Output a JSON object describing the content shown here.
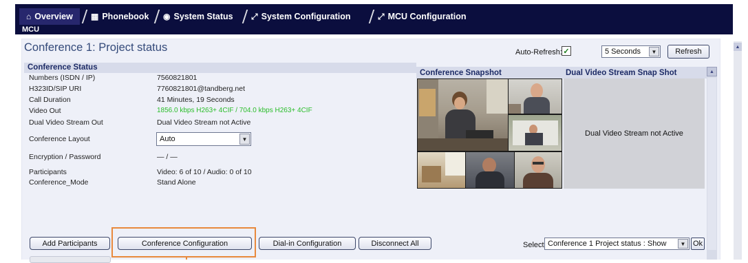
{
  "header": {
    "tabs": [
      {
        "label": "Overview",
        "icon": "home-icon",
        "glyph": "⌂",
        "active": true
      },
      {
        "label": "Phonebook",
        "icon": "phonebook-icon",
        "glyph": "▦",
        "active": false
      },
      {
        "label": "System Status",
        "icon": "gauge-icon",
        "glyph": "◉",
        "active": false
      },
      {
        "label": "System Configuration",
        "icon": "wrench-icon",
        "glyph": "⤢",
        "active": false
      },
      {
        "label": "MCU Configuration",
        "icon": "wrench-icon",
        "glyph": "⤢",
        "active": false
      }
    ],
    "breadcrumb": "MCU",
    "bar_color": "#0b0e3e"
  },
  "page": {
    "title": "Conference 1: Project status",
    "auto_refresh_label": "Auto-Refresh:",
    "auto_refresh_checked": true,
    "refresh_interval": "5 Seconds",
    "refresh_button": "Refresh"
  },
  "status": {
    "title": "Conference Status",
    "rows": [
      {
        "label": "Numbers (ISDN / IP)",
        "value": "7560821801"
      },
      {
        "label": "H323ID/SIP URI",
        "value": "7760821801@tandberg.net"
      },
      {
        "label": "Call Duration",
        "value": "41 Minutes, 19 Seconds"
      },
      {
        "label": "Video Out",
        "value": "1856.0 kbps H263+ 4CIF / 704.0 kbps H263+ 4CIF"
      },
      {
        "label": "Dual Video Stream Out",
        "value": "Dual Video Stream not Active"
      },
      {
        "label": "Conference Layout",
        "value": "Auto"
      },
      {
        "label": "Encryption / Password",
        "value": "— / —"
      },
      {
        "label": "Participants",
        "value": "Video: 6 of 10  / Audio: 0 of 10"
      },
      {
        "label": "Conference_Mode",
        "value": "Stand Alone"
      }
    ],
    "video_out_color": "#2bbd2b"
  },
  "snapshot": {
    "title": "Conference Snapshot",
    "dual_title": "Dual Video Stream Snap Shot",
    "dual_text": "Dual Video Stream not Active"
  },
  "actions": {
    "add_participants": "Add Participants",
    "conference_configuration": "Conference Configuration",
    "dial_in_configuration": "Dial-in Configuration",
    "disconnect_all": "Disconnect All",
    "select_label": "Select:",
    "select_value": "Conference 1 Project status : Show",
    "ok_button": "Ok",
    "highlight_color": "#e8893c"
  }
}
